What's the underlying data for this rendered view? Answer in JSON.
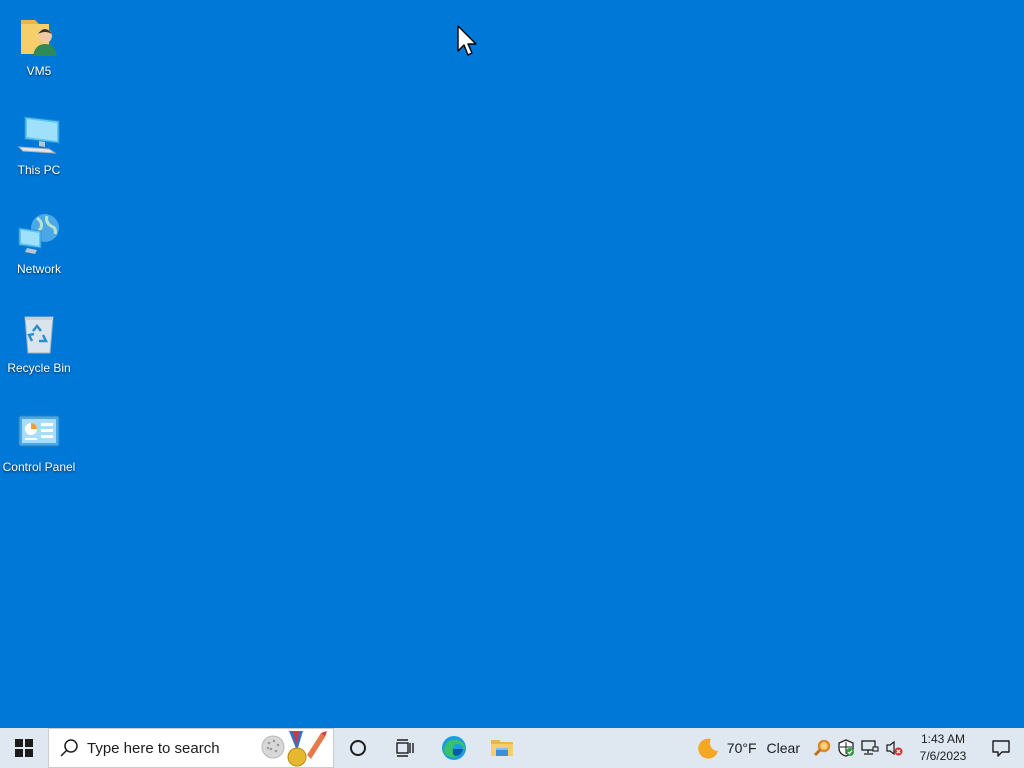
{
  "desktop": {
    "background_color": "#0078d7",
    "icons": [
      {
        "label": "VM5",
        "icon": "user-folder-icon"
      },
      {
        "label": "This PC",
        "icon": "computer-icon"
      },
      {
        "label": "Network",
        "icon": "network-icon"
      },
      {
        "label": "Recycle Bin",
        "icon": "recycle-bin-icon"
      },
      {
        "label": "Control Panel",
        "icon": "control-panel-icon"
      }
    ]
  },
  "taskbar": {
    "search_placeholder": "Type here to search",
    "pinned": [
      "cortana-icon",
      "task-view-icon",
      "edge-icon",
      "file-explorer-icon"
    ],
    "weather": {
      "temperature": "70°F",
      "condition": "Clear"
    },
    "clock": {
      "time": "1:43 AM",
      "date": "7/6/2023"
    }
  }
}
